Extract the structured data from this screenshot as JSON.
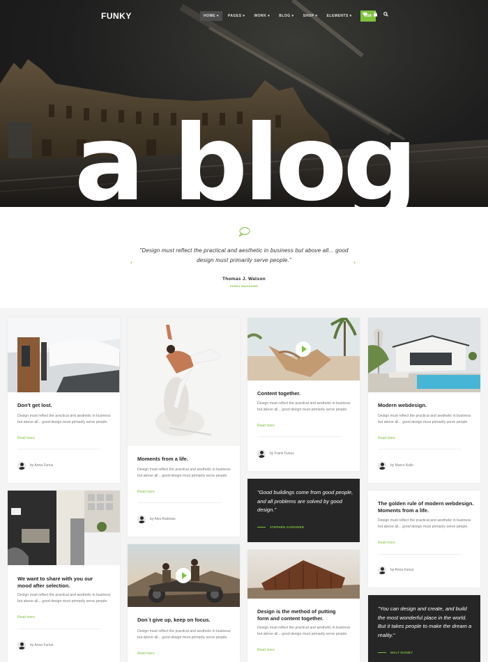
{
  "nav": {
    "logo": "FUNKY",
    "menu": [
      "HOME",
      "PAGES",
      "WORK",
      "BLOG",
      "SHOP",
      "ELEMENTS"
    ],
    "button": "USA",
    "icons": [
      "heart-icon",
      "bag-icon",
      "search-icon"
    ],
    "accent": "#7dc13d"
  },
  "hero": {
    "title": "a blog"
  },
  "quote": {
    "text": "\"Design must reflect the practical and aesthetic in business but above all... good design must primarily serve people.\"",
    "author": "Thomas J. Watson",
    "source": "FUNKY MAGAZINE"
  },
  "cards": {
    "c1": {
      "title": "Don't get lost.",
      "text": "Design must reflect the practical and aesthetic in business but above all... good design must primarily serve people.",
      "more": "Read more",
      "author": "by Anna Furius"
    },
    "c2": {
      "title": "Moments from a life.",
      "text": "Design must reflect the practical and aesthetic in business but above all... good design must primarily serve people.",
      "more": "Read more",
      "author": "by Alex Andrews"
    },
    "c3": {
      "title": "Content together.",
      "text": "Design must reflect the practical and aesthetic in business but above all... good design must primarily serve people.",
      "more": "Read more",
      "author": "by Frank Furius"
    },
    "c4": {
      "title": "Modern webdesign.",
      "text": "Design must reflect the practical and aesthetic in business but above all... good design must primarily serve people.",
      "more": "Read more",
      "author": "by Marco Kuilo"
    },
    "c5": {
      "title": "We want to share with you our mood after selection.",
      "text": "Design must reflect the practical and aesthetic in business but above all... good design must primarily serve people.",
      "more": "Read more",
      "author": "by Anna Furius"
    },
    "c6": {
      "title": "Don´t give up, keep on focus.",
      "text": "Design must reflect the practical and aesthetic in business but above all... good design must primarily serve people.",
      "more": "Read more"
    },
    "c7": {
      "quote": "\"Good buildings come from good people, and all problems are solved by good design.\"",
      "author": "STEPHEN GARDINER"
    },
    "c8": {
      "title": "Design is the method of putting form and content together.",
      "text": "Design must reflect the practical and aesthetic in business but above all... good design must primarily serve people.",
      "more": "Read more"
    },
    "c9": {
      "title": "The golden rule of modern webdesign. Moments from a life.",
      "text": "Design must reflect the practical and aesthetic in business but above all... good design must primarily serve people.",
      "more": "Read more",
      "author": "by Anna Furius"
    },
    "c10": {
      "quote": "\"You can design and create, and build the most wonderful place in the world. But it takes people to make the dream a reality.\"",
      "author": "WALT DISNEY"
    }
  }
}
